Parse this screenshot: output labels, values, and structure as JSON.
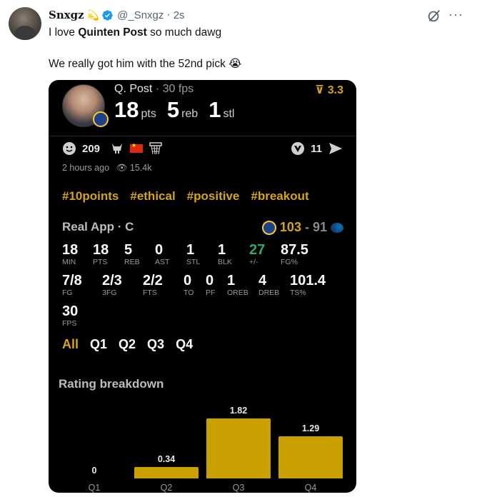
{
  "tweet": {
    "display_name": "Snxgz",
    "name_emoji": "💫",
    "handle": "@_Snxgz",
    "time": "2s",
    "text_line1_a": "I love ",
    "text_line1_b": "Quinten Post",
    "text_line1_c": " so much dawg",
    "text_line2": "We really got him with the 52nd pick",
    "text_line2_emoji": "😭"
  },
  "card": {
    "player": "Q. Post",
    "fps_label": "30 fps",
    "top_rating": "3.3",
    "big_stats": [
      {
        "value": "18",
        "label": "pts"
      },
      {
        "value": "5",
        "label": "reb"
      },
      {
        "value": "1",
        "label": "stl"
      }
    ],
    "reaction_count": "209",
    "share_count": "11",
    "posted": "2 hours ago",
    "views": "15.4k",
    "hashtags": [
      "#10points",
      "#ethical",
      "#positive",
      "#breakout"
    ],
    "game_label": "Real App · C",
    "score_team": "103",
    "score_sep": "-",
    "score_opp": "91",
    "stats_row1": [
      {
        "value": "18",
        "label": "MIN"
      },
      {
        "value": "18",
        "label": "PTS"
      },
      {
        "value": "5",
        "label": "REB"
      },
      {
        "value": "0",
        "label": "AST"
      },
      {
        "value": "1",
        "label": "STL"
      },
      {
        "value": "1",
        "label": "BLK"
      },
      {
        "value": "27",
        "label": "+/-"
      },
      {
        "value": "87.5",
        "label": "FG%"
      }
    ],
    "stats_row2": [
      {
        "value": "7/8",
        "label": "FG"
      },
      {
        "value": "2/3",
        "label": "3FG"
      },
      {
        "value": "2/2",
        "label": "FTS"
      },
      {
        "value": "0",
        "label": "TO"
      },
      {
        "value": "0",
        "label": "PF"
      },
      {
        "value": "1",
        "label": "OREB"
      },
      {
        "value": "4",
        "label": "DREB"
      },
      {
        "value": "101.4",
        "label": "TS%"
      }
    ],
    "stats_row3": [
      {
        "value": "30",
        "label": "FPS"
      }
    ],
    "quarter_tabs": [
      "All",
      "Q1",
      "Q2",
      "Q3",
      "Q4"
    ],
    "breakdown_title": "Rating breakdown"
  },
  "colors": {
    "accent_gold": "#d4a514",
    "bar_gold": "#caa000",
    "plus_minus_green": "#2ea96b",
    "card_bg": "#000000"
  },
  "chart_data": {
    "type": "bar",
    "title": "Rating breakdown",
    "categories": [
      "Q1",
      "Q2",
      "Q3",
      "Q4"
    ],
    "values": [
      0,
      0.34,
      1.82,
      1.29
    ],
    "value_labels": [
      "0",
      "0.34",
      "1.82",
      "1.29"
    ],
    "ylim": [
      0,
      2
    ]
  }
}
